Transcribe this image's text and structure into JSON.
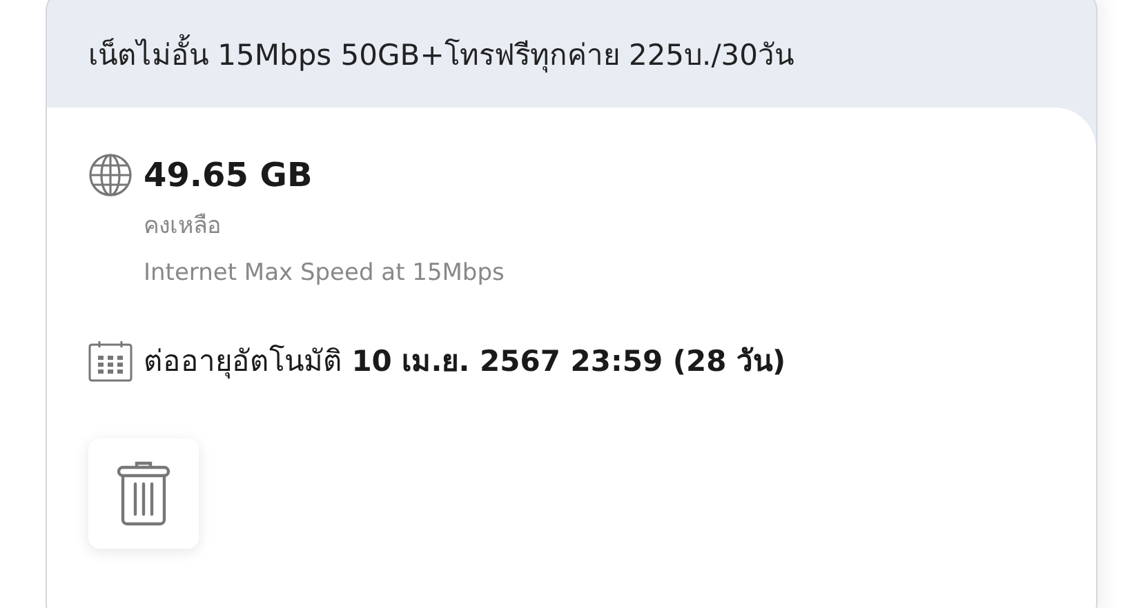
{
  "package": {
    "title": "เน็ตไม่อั้น 15Mbps 50GB+โทรฟรีทุกค่าย 225บ./30วัน",
    "data_balance": {
      "amount": "49.65 GB",
      "label": "คงเหลือ",
      "description": "Internet Max Speed at 15Mbps"
    },
    "renewal": "ต่ออายุอัตโนมัติ **10 เม.ย. 2567 23:59 (28 วัน)**"
  }
}
